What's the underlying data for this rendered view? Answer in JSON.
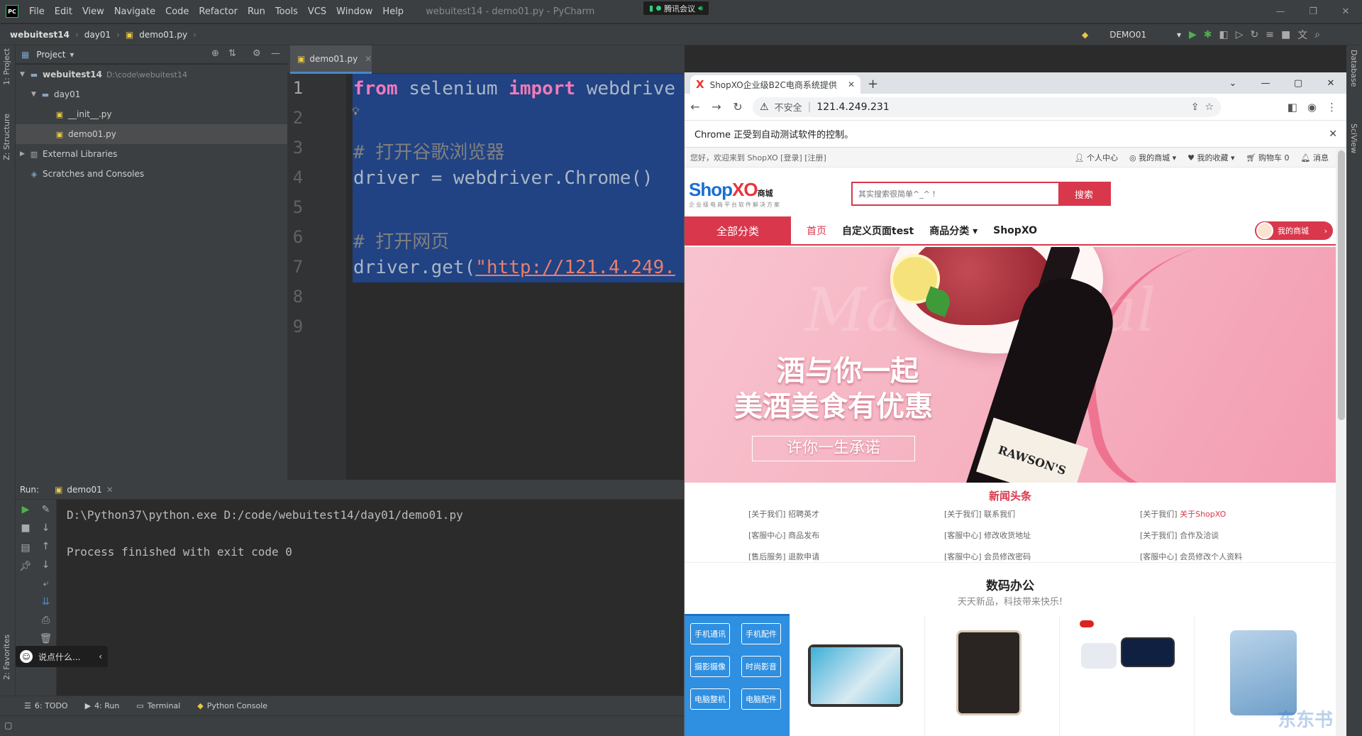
{
  "ide": {
    "app_icon": "PC",
    "menu": [
      "File",
      "Edit",
      "View",
      "Navigate",
      "Code",
      "Refactor",
      "Run",
      "Tools",
      "VCS",
      "Window",
      "Help"
    ],
    "window_title": "webuitest14 - demo01.py - PyCharm",
    "meeting": "腾讯会议",
    "breadcrumbs": [
      "webuitest14",
      "day01",
      "demo01.py"
    ],
    "run_config": "DEMO01",
    "left_strip": [
      "1: Project",
      "Z: Structure",
      "2: Favorites"
    ],
    "right_strip": [
      "Database",
      "SciView"
    ],
    "project_header": "Project",
    "tree": [
      {
        "label": "webuitest14",
        "path": "D:\\code\\webuitest14",
        "icon": "folder-icon"
      },
      {
        "label": "day01",
        "icon": "folder-icon"
      },
      {
        "label": "__init__.py",
        "icon": "python-file-icon"
      },
      {
        "label": "demo01.py",
        "icon": "python-file-icon"
      },
      {
        "label": "External Libraries",
        "icon": "library-icon"
      },
      {
        "label": "Scratches and Consoles",
        "icon": "scratch-icon"
      }
    ],
    "editor_tab": "demo01.py",
    "line_numbers": [
      "1",
      "2",
      "3",
      "4",
      "5",
      "6",
      "7",
      "8",
      "9"
    ],
    "code": {
      "l1_kw1": "from",
      "l1_mod": " selenium ",
      "l1_kw2": "import",
      "l1_rest": " webdrive",
      "l3": "# 打开谷歌浏览器",
      "l4_a": "driver = webdriver.",
      "l4_fn": "Chrome",
      "l4_b": "()",
      "l6": "# 打开网页",
      "l7_a": "driver.",
      "l7_fn": "get",
      "l7_b": "(",
      "l7_str": "\"http://121.4.249."
    },
    "run_label": "Run:",
    "run_tab": "demo01",
    "output": [
      "D:\\Python37\\python.exe D:/code/webuitest14/day01/demo01.py",
      "Process finished with exit code 0"
    ],
    "chat_placeholder": "说点什么...",
    "bottom_tabs": [
      "6: TODO",
      "4: Run",
      "Terminal",
      "Python Console"
    ]
  },
  "chrome": {
    "tab_title": "ShopXO企业级B2C电商系统提供",
    "insecure": "不安全",
    "url": "121.4.249.231",
    "infobar": "Chrome 正受到自动测试软件的控制。"
  },
  "shop": {
    "greeting": "您好，欢迎来到 ShopXO [登录] [注册]",
    "toplinks": [
      "个人中心",
      "我的商城",
      "我的收藏",
      "购物车 0",
      "消息"
    ],
    "logo_a": "Shop",
    "logo_b": "XO",
    "logo_cn": "商城",
    "logo_sub": "企业级电商平台软件解决方案",
    "search_placeholder": "其实搜索很简单^_^ !",
    "search_button": "搜索",
    "all_categories": "全部分类",
    "nav": [
      "首页",
      "自定义页面test",
      "商品分类",
      "ShopXO"
    ],
    "my_mall": "我的商城",
    "banner_line1": "酒与你一起",
    "banner_line2": "美酒美食有优惠",
    "banner_line3": "许你一生承诺",
    "banner_bg": "Ma   Festival",
    "bottle_label": "RAWSON'S",
    "news_title": "新闻头条",
    "news": [
      [
        "[关于我们] 招聘英才",
        "[关于我们] 联系我们",
        "[关于我们] ",
        "关于ShopXO"
      ],
      [
        "[客服中心] 商品发布",
        "[客服中心] 修改收货地址",
        "[关于我们] 合作及洽谈"
      ],
      [
        "[售后服务] 退款申请",
        "[客服中心] 会员修改密码",
        "[客服中心] 会员修改个人资料"
      ]
    ],
    "floor_title": "数码办公",
    "floor_sub": "天天新品，科技带来快乐!",
    "cat_buttons": [
      "手机通讯",
      "手机配件",
      "摄影摄像",
      "时尚影音",
      "电脑整机",
      "电脑配件"
    ],
    "watermark": "东东书"
  }
}
